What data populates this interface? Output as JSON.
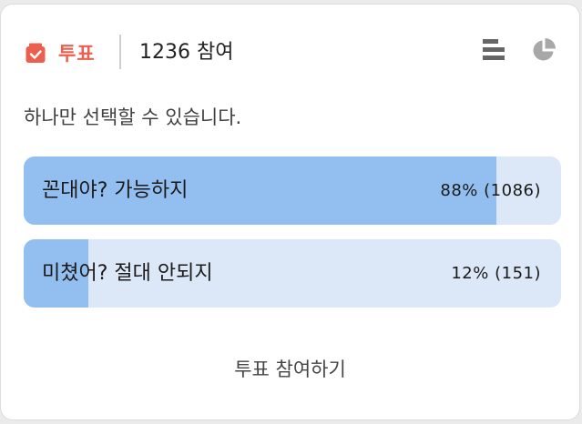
{
  "header": {
    "vote_label": "투표",
    "participants": "1236 참여",
    "vote_icon": "ballot-box-icon",
    "list_icon": "list-icon",
    "pie_icon": "pie-chart-icon"
  },
  "instruction": "하나만 선택할 수 있습니다.",
  "options": [
    {
      "label": "꼰대야? 가능하지",
      "percent": 88,
      "count": 1086,
      "result": "88% (1086)"
    },
    {
      "label": "미쳤어? 절대 안되지",
      "percent": 12,
      "count": 151,
      "result": "12% (151)"
    }
  ],
  "submit_label": "투표 참여하기",
  "colors": {
    "accent": "#ec5f4f",
    "bar_fill": "#93bff0",
    "bar_track": "#dce8f7",
    "icon_gray": "#666666"
  }
}
